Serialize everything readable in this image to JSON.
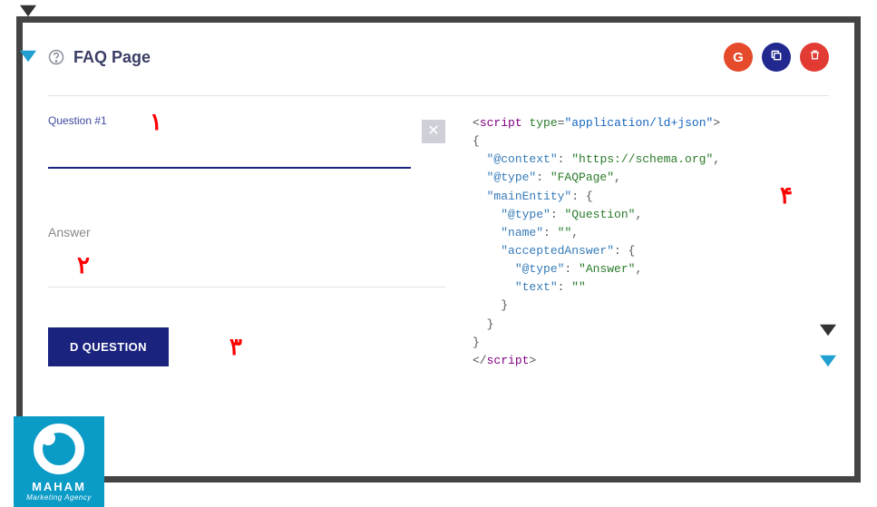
{
  "header": {
    "title": "FAQ Page",
    "google_label": "G"
  },
  "left": {
    "question_label": "Question #1",
    "question_value": "",
    "answer_label": "Answer",
    "answer_value": "",
    "add_button_label": "D QUESTION"
  },
  "code": {
    "open_tag_name": "script",
    "type_attr": "type",
    "type_val": "\"application/ld+json\"",
    "brace_open": "{",
    "k_context": "\"@context\"",
    "v_context": "\"https://schema.org\"",
    "k_type": "\"@type\"",
    "v_type": "\"FAQPage\"",
    "k_main": "\"mainEntity\"",
    "k_qtype": "\"@type\"",
    "v_qtype": "\"Question\"",
    "k_name": "\"name\"",
    "v_name": "\"\"",
    "k_accepted": "\"acceptedAnswer\"",
    "k_atype": "\"@type\"",
    "v_atype": "\"Answer\"",
    "k_text": "\"text\"",
    "v_text": "\"\"",
    "brace_close": "}",
    "close_tag": "script"
  },
  "annotations": {
    "n1": "۱",
    "n2": "۲",
    "n3": "۳",
    "n4": "۴"
  },
  "watermark": {
    "line1": "MAHAM",
    "line2": "Marketing Agency"
  }
}
